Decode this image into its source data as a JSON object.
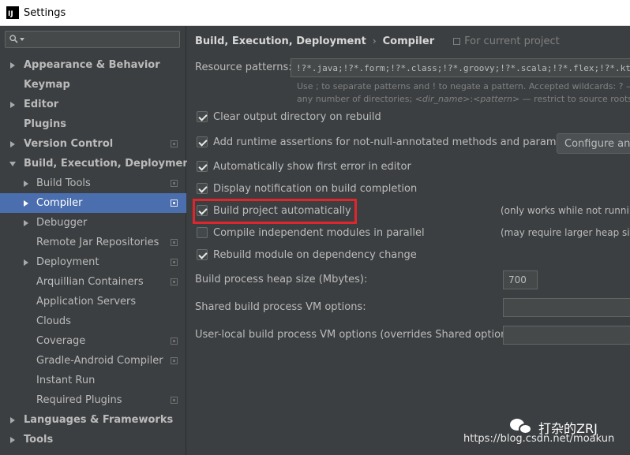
{
  "window": {
    "title": "Settings",
    "logo_text": "IJ"
  },
  "sidebar": {
    "search": {
      "value": "",
      "placeholder": ""
    },
    "items": [
      {
        "label": "Appearance & Behavior"
      },
      {
        "label": "Keymap"
      },
      {
        "label": "Editor"
      },
      {
        "label": "Plugins"
      },
      {
        "label": "Version Control"
      },
      {
        "label": "Build, Execution, Deployment"
      },
      {
        "label": "Build Tools"
      },
      {
        "label": "Compiler"
      },
      {
        "label": "Debugger"
      },
      {
        "label": "Remote Jar Repositories"
      },
      {
        "label": "Deployment"
      },
      {
        "label": "Arquillian Containers"
      },
      {
        "label": "Application Servers"
      },
      {
        "label": "Clouds"
      },
      {
        "label": "Coverage"
      },
      {
        "label": "Gradle-Android Compiler"
      },
      {
        "label": "Instant Run"
      },
      {
        "label": "Required Plugins"
      },
      {
        "label": "Languages & Frameworks"
      },
      {
        "label": "Tools"
      }
    ],
    "selected": "Compiler"
  },
  "main": {
    "breadcrumb": {
      "parent": "Build, Execution, Deployment",
      "separator": "›",
      "current": "Compiler",
      "scope_note": "For current project"
    },
    "resource_patterns": {
      "label": "Resource patterns:",
      "value": "!?*.java;!?*.form;!?*.class;!?*.groovy;!?*.scala;!?*.flex;!?*.kt;!?*.c",
      "hint_line1": "Use ; to separate patterns and ! to negate a pattern. Accepted wildcards: ? — exa",
      "hint_line2_a": "any number of directories; ",
      "hint_line2_b": "<dir_name>",
      "hint_line2_c": ":",
      "hint_line2_d": "<pattern>",
      "hint_line2_e": " — restrict to source roots with"
    },
    "options": [
      {
        "label": "Clear output directory on rebuild",
        "checked": true
      },
      {
        "label": "Add runtime assertions for not-null-annotated methods and parameters",
        "checked": true
      },
      {
        "label": "Automatically show first error in editor",
        "checked": true
      },
      {
        "label": "Display notification on build completion",
        "checked": true
      },
      {
        "label": "Build project automatically",
        "checked": true,
        "note": "(only works while not runnin"
      },
      {
        "label": "Compile independent modules in parallel",
        "checked": false,
        "note": "(may require larger heap siz"
      },
      {
        "label": "Rebuild module on dependency change",
        "checked": true
      }
    ],
    "configure_button": "Configure anno",
    "heap_size": {
      "label": "Build process heap size (Mbytes):",
      "value": "700"
    },
    "shared_vm": {
      "label": "Shared build process VM options:",
      "value": ""
    },
    "user_local_vm": {
      "label": "User-local build process VM options (overrides Shared options):",
      "value": ""
    }
  },
  "watermark": {
    "account": "打杂的ZRJ",
    "url": "https://blog.csdn.net/moakun"
  },
  "colors": {
    "background": "#3c3f41",
    "selection": "#4b6eaf",
    "highlight_box": "#e0262d"
  }
}
